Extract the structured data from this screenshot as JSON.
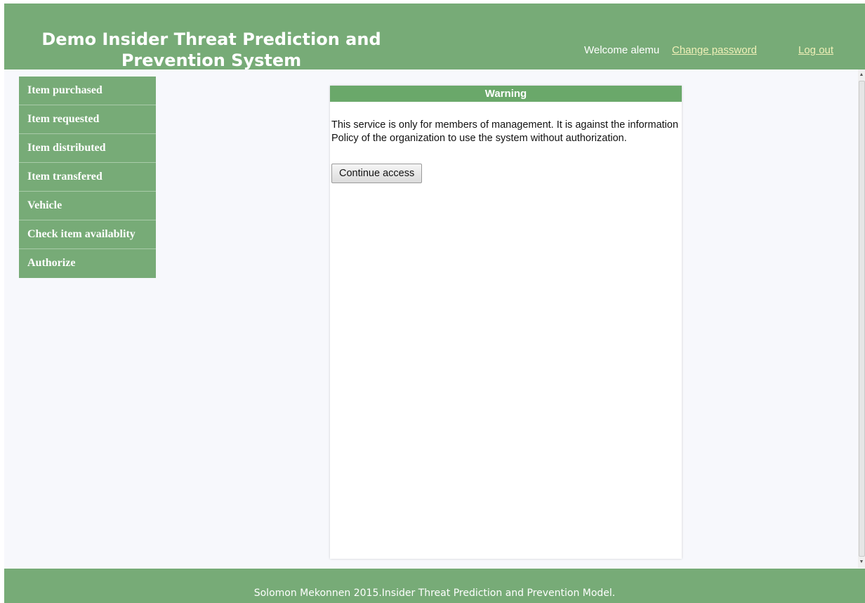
{
  "header": {
    "title": "Demo Insider Threat Prediction and Prevention System",
    "welcome": "Welcome alemu",
    "change_password": "Change password",
    "logout": "Log out"
  },
  "sidebar": {
    "items": [
      {
        "label": "Item purchased"
      },
      {
        "label": "Item requested"
      },
      {
        "label": "Item distributed"
      },
      {
        "label": "Item transfered"
      },
      {
        "label": "Vehicle"
      },
      {
        "label": "Check item availablity"
      },
      {
        "label": "Authorize"
      }
    ]
  },
  "warning": {
    "title": "Warning",
    "message": "This service is only for members of management. It is against the information Policy of the organization to use the system without authorization.",
    "button": "Continue access"
  },
  "footer": {
    "text": "Solomon Mekonnen 2015.Insider Threat Prediction and Prevention Model."
  },
  "colors": {
    "header_green": "#77ab77",
    "panel_header_green": "#6aa86a",
    "link_color": "#f0f0b8",
    "background": "#f7f8fc"
  }
}
